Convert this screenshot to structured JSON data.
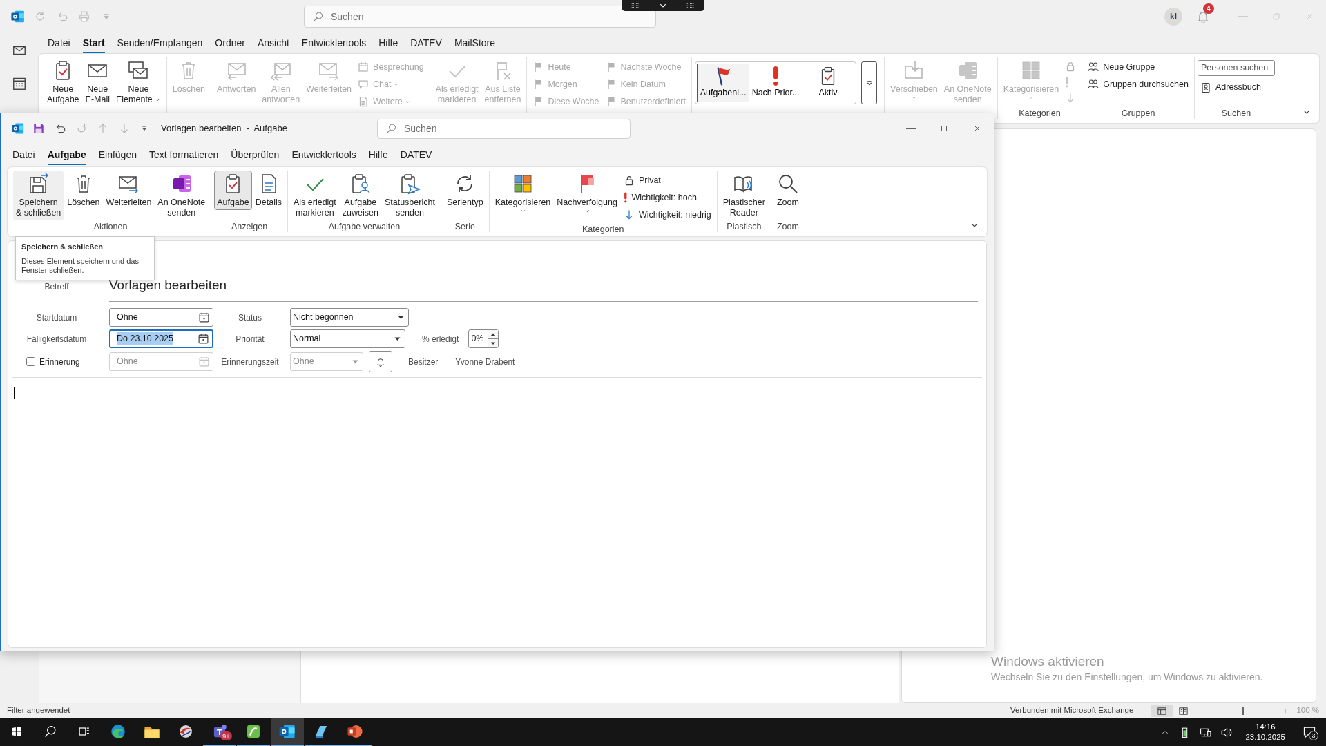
{
  "main_window": {
    "title_bar": {
      "search_placeholder": "Suchen",
      "account_initials": "kl",
      "notification_count": "4"
    },
    "tabs": [
      {
        "label": "Datei",
        "selected": false
      },
      {
        "label": "Start",
        "selected": true
      },
      {
        "label": "Senden/Empfangen",
        "selected": false
      },
      {
        "label": "Ordner",
        "selected": false
      },
      {
        "label": "Ansicht",
        "selected": false
      },
      {
        "label": "Entwicklertools",
        "selected": false
      },
      {
        "label": "Hilfe",
        "selected": false
      },
      {
        "label": "DATEV",
        "selected": false
      },
      {
        "label": "MailStore",
        "selected": false
      }
    ],
    "ribbon": [
      {
        "items": [
          {
            "kind": "large",
            "label": [
              "Neue",
              "Aufgabe"
            ],
            "disabled": false
          },
          {
            "kind": "large",
            "label": [
              "Neue",
              "E-Mail"
            ],
            "disabled": false
          },
          {
            "kind": "large",
            "label": [
              "Neue",
              "Elemente"
            ],
            "disabled": false,
            "dropdown": true
          }
        ]
      },
      {
        "items": [
          {
            "kind": "large",
            "label": [
              "Löschen"
            ],
            "disabled": true
          }
        ]
      },
      {
        "items": [
          {
            "kind": "large",
            "label": [
              "Antworten"
            ],
            "disabled": true
          },
          {
            "kind": "large",
            "label": [
              "Allen",
              "antworten"
            ],
            "disabled": true
          },
          {
            "kind": "large",
            "label": [
              "Weiterleiten"
            ],
            "disabled": true
          },
          {
            "kind": "stack",
            "items": [
              {
                "label": "Besprechung",
                "disabled": true
              },
              {
                "label": "Chat",
                "disabled": true,
                "dropdown": true
              },
              {
                "label": "Weitere",
                "disabled": true,
                "dropdown": true
              }
            ]
          }
        ]
      },
      {
        "items": [
          {
            "kind": "large",
            "label": [
              "Als erledigt",
              "markieren"
            ],
            "disabled": true
          },
          {
            "kind": "large",
            "label": [
              "Aus Liste",
              "entfernen"
            ],
            "disabled": true
          }
        ]
      },
      {
        "items": [
          {
            "kind": "stack",
            "items": [
              {
                "label": "Heute",
                "disabled": true
              },
              {
                "label": "Morgen",
                "disabled": true
              },
              {
                "label": "Diese Woche",
                "disabled": true
              }
            ]
          },
          {
            "kind": "stack",
            "items": [
              {
                "label": "Nächste Woche",
                "disabled": true
              },
              {
                "label": "Kein Datum",
                "disabled": true
              },
              {
                "label": "Benutzerdefiniert",
                "disabled": true
              }
            ]
          }
        ]
      },
      {
        "items": [
          {
            "kind": "gallery",
            "items": [
              {
                "label": "Aufgabenl...",
                "selected": true
              },
              {
                "label": "Nach Prior...",
                "selected": false
              },
              {
                "label": "Aktiv",
                "selected": false
              }
            ]
          }
        ]
      },
      {
        "items": [
          {
            "kind": "large",
            "label": [
              "Verschieben"
            ],
            "disabled": true,
            "dropdown": true
          },
          {
            "kind": "large",
            "label": [
              "An OneNote",
              "senden"
            ],
            "disabled": true
          }
        ]
      },
      {
        "label": "Kategorien",
        "items": [
          {
            "kind": "large",
            "label": [
              "Kategorisieren"
            ],
            "disabled": true,
            "dropdown": true
          },
          {
            "kind": "icons",
            "items": [
              {
                "disabled": true
              },
              {
                "disabled": true
              },
              {
                "disabled": true
              }
            ]
          }
        ]
      },
      {
        "label": "Gruppen",
        "items": [
          {
            "kind": "stack",
            "items": [
              {
                "label": "Neue Gruppe",
                "disabled": false
              },
              {
                "label": "Gruppen durchsuchen",
                "disabled": false
              }
            ]
          }
        ]
      },
      {
        "label": "Suchen",
        "items": [
          {
            "kind": "stack",
            "items": [
              {
                "kind": "field",
                "placeholder": "Personen suchen"
              },
              {
                "label": "Adressbuch",
                "disabled": false
              }
            ]
          }
        ]
      }
    ]
  },
  "task_window": {
    "title": "Vorlagen bearbeiten  -  Aufgabe",
    "search_placeholder": "Suchen",
    "tabs": [
      {
        "label": "Datei",
        "selected": false
      },
      {
        "label": "Aufgabe",
        "selected": true
      },
      {
        "label": "Einfügen",
        "selected": false
      },
      {
        "label": "Text formatieren",
        "selected": false
      },
      {
        "label": "Überprüfen",
        "selected": false
      },
      {
        "label": "Entwicklertools",
        "selected": false
      },
      {
        "label": "Hilfe",
        "selected": false
      },
      {
        "label": "DATEV",
        "selected": false
      }
    ],
    "ribbon": [
      {
        "label": "Aktionen",
        "items": [
          {
            "kind": "large",
            "label": [
              "Speichern",
              "& schließen"
            ],
            "disabled": false,
            "hovered": true
          },
          {
            "kind": "large",
            "label": [
              "Löschen"
            ],
            "disabled": false
          },
          {
            "kind": "large",
            "label": [
              "Weiterleiten"
            ],
            "disabled": false
          },
          {
            "kind": "large",
            "label": [
              "An OneNote",
              "senden"
            ],
            "disabled": false
          }
        ]
      },
      {
        "label": "Anzeigen",
        "items": [
          {
            "kind": "large",
            "label": [
              "Aufgabe"
            ],
            "disabled": false,
            "selected": true
          },
          {
            "kind": "large",
            "label": [
              "Details"
            ],
            "disabled": false,
            "selected": false
          }
        ]
      },
      {
        "label": "Aufgabe verwalten",
        "items": [
          {
            "kind": "large",
            "label": [
              "Als erledigt",
              "markieren"
            ],
            "disabled": false
          },
          {
            "kind": "large",
            "label": [
              "Aufgabe",
              "zuweisen"
            ],
            "disabled": false
          },
          {
            "kind": "large",
            "label": [
              "Statusbericht",
              "senden"
            ],
            "disabled": false
          }
        ]
      },
      {
        "label": "Serie",
        "items": [
          {
            "kind": "large",
            "label": [
              "Serientyp"
            ],
            "disabled": false
          }
        ]
      },
      {
        "label": "Kategorien",
        "items": [
          {
            "kind": "large",
            "label": [
              "Kategorisieren"
            ],
            "disabled": false,
            "dropdown": true
          },
          {
            "kind": "large",
            "label": [
              "Nachverfolgung"
            ],
            "disabled": false,
            "dropdown": true
          },
          {
            "kind": "stack",
            "items": [
              {
                "label": "Privat",
                "disabled": false
              },
              {
                "label": "Wichtigkeit: hoch",
                "disabled": false
              },
              {
                "label": "Wichtigkeit: niedrig",
                "disabled": false
              }
            ]
          }
        ]
      },
      {
        "label": "Plastisch",
        "items": [
          {
            "kind": "large",
            "label": [
              "Plastischer",
              "Reader"
            ],
            "disabled": false
          }
        ]
      },
      {
        "label": "Zoom",
        "items": [
          {
            "kind": "large",
            "label": [
              "Zoom"
            ],
            "disabled": false
          }
        ]
      }
    ],
    "tooltip": {
      "title": "Speichern & schließen",
      "text": "Dieses Element speichern und das Fenster schließen."
    },
    "form": {
      "subject_label": "Betreff",
      "subject": "Vorlagen bearbeiten",
      "start_label": "Startdatum",
      "start_value": "Ohne",
      "status_label": "Status",
      "status_value": "Nicht begonnen",
      "due_label": "Fälligkeitsdatum",
      "due_value": "Do 23.10.2025",
      "due_focused": true,
      "priority_label": "Priorität",
      "priority_value": "Normal",
      "percent_label": "% erledigt",
      "percent_value": "0%",
      "reminder": {
        "label": "Erinnerung",
        "checked": false,
        "date": "Ohne",
        "time_label": "Erinnerungszeit",
        "time": "Ohne"
      },
      "owner_label": "Besitzer",
      "owner": "Yvonne Drabent"
    }
  },
  "status_bar": {
    "left": "Filter angewendet",
    "connection": "Verbunden mit Microsoft Exchange",
    "zoom_slider": {
      "level": 0.5
    },
    "zoom": "100 %"
  },
  "activation_notice": {
    "title": "Windows aktivieren",
    "text": "Wechseln Sie zu den Einstellungen, um Windows zu aktivieren."
  },
  "taskbar": {
    "apps": [
      {
        "running": false,
        "active": false
      },
      {
        "running": false,
        "active": false
      },
      {
        "running": false,
        "active": false
      },
      {
        "running": true,
        "active": false,
        "badge": "9+"
      },
      {
        "running": true,
        "active": false
      },
      {
        "running": true,
        "active": true
      },
      {
        "running": true,
        "active": false
      },
      {
        "running": true,
        "active": false
      }
    ],
    "time": "14:16",
    "date": "23.10.2025",
    "notification_count": "3"
  }
}
